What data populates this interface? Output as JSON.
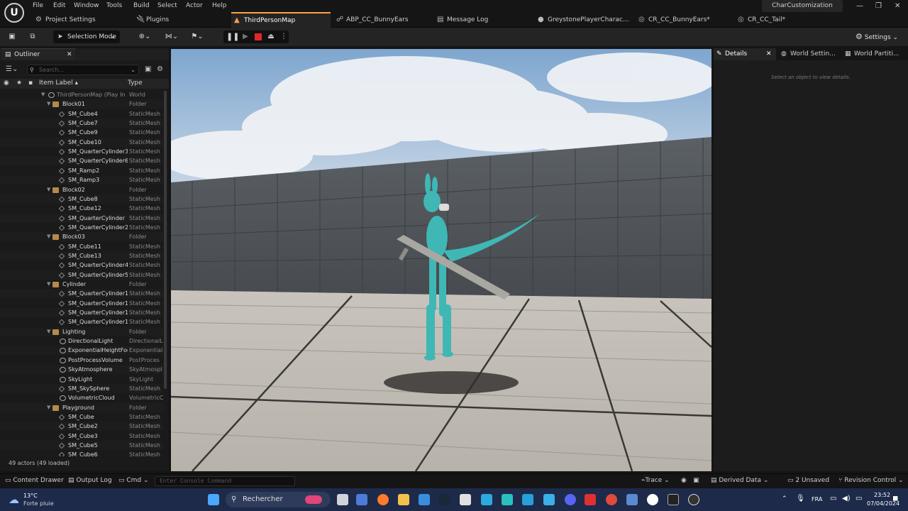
{
  "menu": [
    "File",
    "Edit",
    "Window",
    "Tools",
    "Build",
    "Select",
    "Actor",
    "Help"
  ],
  "project_name": "CharCustomization",
  "window_controls": [
    "—",
    "❐",
    "✕"
  ],
  "tabs": [
    {
      "label": "Project Settings",
      "icon": "⚙"
    },
    {
      "label": "Plugins",
      "icon": "🔌"
    },
    {
      "label": "ThirdPersonMap",
      "icon": "▲",
      "active": true
    },
    {
      "label": "ABP_CC_BunnyEars",
      "icon": "☍"
    },
    {
      "label": "Message Log",
      "icon": "▤"
    },
    {
      "label": "GreystonePlayerCharac...",
      "icon": "●"
    },
    {
      "label": "CR_CC_BunnyEars*",
      "icon": "◎"
    },
    {
      "label": "CR_CC_Tail*",
      "icon": "◎"
    }
  ],
  "toolbar": {
    "mode": "Selection Mode",
    "settings": "Settings"
  },
  "outliner": {
    "title": "Outliner",
    "search_placeholder": "Search...",
    "col_label": "Item Label ▴",
    "col_type": "Type",
    "rows": [
      {
        "label": "ThirdPersonMap (Play In",
        "type": "World",
        "kind": "world",
        "indent": 0
      },
      {
        "label": "Block01",
        "type": "Folder",
        "kind": "folder",
        "indent": 1
      },
      {
        "label": "SM_Cube4",
        "type": "StaticMesh",
        "kind": "mesh",
        "indent": 2
      },
      {
        "label": "SM_Cube7",
        "type": "StaticMesh",
        "kind": "mesh",
        "indent": 2
      },
      {
        "label": "SM_Cube9",
        "type": "StaticMesh",
        "kind": "mesh",
        "indent": 2
      },
      {
        "label": "SM_Cube10",
        "type": "StaticMesh",
        "kind": "mesh",
        "indent": 2
      },
      {
        "label": "SM_QuarterCylinder3",
        "type": "StaticMesh",
        "kind": "mesh",
        "indent": 2
      },
      {
        "label": "SM_QuarterCylinder6",
        "type": "StaticMesh",
        "kind": "mesh",
        "indent": 2
      },
      {
        "label": "SM_Ramp2",
        "type": "StaticMesh",
        "kind": "mesh",
        "indent": 2
      },
      {
        "label": "SM_Ramp3",
        "type": "StaticMesh",
        "kind": "mesh",
        "indent": 2
      },
      {
        "label": "Block02",
        "type": "Folder",
        "kind": "folder",
        "indent": 1
      },
      {
        "label": "SM_Cube8",
        "type": "StaticMesh",
        "kind": "mesh",
        "indent": 2
      },
      {
        "label": "SM_Cube12",
        "type": "StaticMesh",
        "kind": "mesh",
        "indent": 2
      },
      {
        "label": "SM_QuarterCylinder",
        "type": "StaticMesh",
        "kind": "mesh",
        "indent": 2
      },
      {
        "label": "SM_QuarterCylinder2",
        "type": "StaticMesh",
        "kind": "mesh",
        "indent": 2
      },
      {
        "label": "Block03",
        "type": "Folder",
        "kind": "folder",
        "indent": 1
      },
      {
        "label": "SM_Cube11",
        "type": "StaticMesh",
        "kind": "mesh",
        "indent": 2
      },
      {
        "label": "SM_Cube13",
        "type": "StaticMesh",
        "kind": "mesh",
        "indent": 2
      },
      {
        "label": "SM_QuarterCylinder4",
        "type": "StaticMesh",
        "kind": "mesh",
        "indent": 2
      },
      {
        "label": "SM_QuarterCylinder5",
        "type": "StaticMesh",
        "kind": "mesh",
        "indent": 2
      },
      {
        "label": "Cylinder",
        "type": "Folder",
        "kind": "folder",
        "indent": 1
      },
      {
        "label": "SM_QuarterCylinder1",
        "type": "StaticMesh",
        "kind": "mesh",
        "indent": 2
      },
      {
        "label": "SM_QuarterCylinder1",
        "type": "StaticMesh",
        "kind": "mesh",
        "indent": 2
      },
      {
        "label": "SM_QuarterCylinder1",
        "type": "StaticMesh",
        "kind": "mesh",
        "indent": 2
      },
      {
        "label": "SM_QuarterCylinder1",
        "type": "StaticMesh",
        "kind": "mesh",
        "indent": 2
      },
      {
        "label": "Lighting",
        "type": "Folder",
        "kind": "folder",
        "indent": 1
      },
      {
        "label": "DirectionalLight",
        "type": "DirectionalL",
        "kind": "light",
        "indent": 2
      },
      {
        "label": "ExponentialHeightFog",
        "type": "Exponentiall",
        "kind": "light",
        "indent": 2
      },
      {
        "label": "PostProcessVolume",
        "type": "PostProces",
        "kind": "light",
        "indent": 2
      },
      {
        "label": "SkyAtmosphere",
        "type": "SkyAtmospl",
        "kind": "light",
        "indent": 2
      },
      {
        "label": "SkyLight",
        "type": "SkyLight",
        "kind": "light",
        "indent": 2
      },
      {
        "label": "SM_SkySphere",
        "type": "StaticMesh",
        "kind": "mesh",
        "indent": 2
      },
      {
        "label": "VolumetricCloud",
        "type": "VolumetricC",
        "kind": "light",
        "indent": 2
      },
      {
        "label": "Playground",
        "type": "Folder",
        "kind": "folder",
        "indent": 1
      },
      {
        "label": "SM_Cube",
        "type": "StaticMesh",
        "kind": "mesh",
        "indent": 2
      },
      {
        "label": "SM_Cube2",
        "type": "StaticMesh",
        "kind": "mesh",
        "indent": 2
      },
      {
        "label": "SM_Cube3",
        "type": "StaticMesh",
        "kind": "mesh",
        "indent": 2
      },
      {
        "label": "SM_Cube5",
        "type": "StaticMesh",
        "kind": "mesh",
        "indent": 2
      },
      {
        "label": "SM_Cube6",
        "type": "StaticMesh",
        "kind": "mesh",
        "indent": 2
      }
    ],
    "actors_count": "49 actors (49 loaded)"
  },
  "details": {
    "tabs": [
      "Details",
      "World Settin...",
      "World Partiti..."
    ],
    "hint": "Select an object to view details."
  },
  "statusbar": {
    "content_drawer": "Content Drawer",
    "output_log": "Output Log",
    "cmd": "Cmd",
    "console_placeholder": "Enter Console Command",
    "trace": "Trace",
    "derived_data": "Derived Data",
    "unsaved": "2 Unsaved",
    "revision_control": "Revision Control"
  },
  "taskbar": {
    "weather_temp": "13°C",
    "weather_desc": "Forte pluie",
    "search": "Rechercher",
    "lang": "FRA",
    "time": "23:52",
    "date": "07/04/2024"
  },
  "colors": {
    "accent": "#ffa24a",
    "character": "#3fb7b5",
    "sky": "#8fb4d6"
  }
}
